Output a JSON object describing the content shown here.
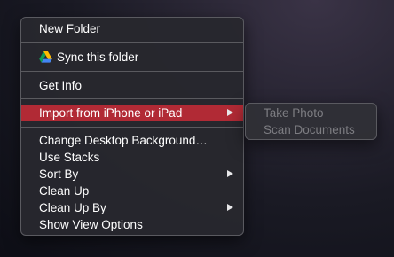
{
  "context_menu": {
    "items": {
      "new_folder": "New Folder",
      "sync_folder": "Sync this folder",
      "get_info": "Get Info",
      "import": "Import from iPhone or iPad",
      "change_bg": "Change Desktop Background…",
      "use_stacks": "Use Stacks",
      "sort_by": "Sort By",
      "clean_up": "Clean Up",
      "clean_up_by": "Clean Up By",
      "show_view_options": "Show View Options"
    }
  },
  "import_submenu": {
    "items": {
      "take_photo": "Take Photo",
      "scan_documents": "Scan Documents"
    },
    "state": "disabled"
  },
  "colors": {
    "highlight": "#b12a35",
    "menu_bg": "#28282e",
    "disabled_text": "#7d7d82"
  },
  "icons": {
    "sync": "google-drive-icon",
    "submenu_indicator": "chevron-right-icon"
  }
}
